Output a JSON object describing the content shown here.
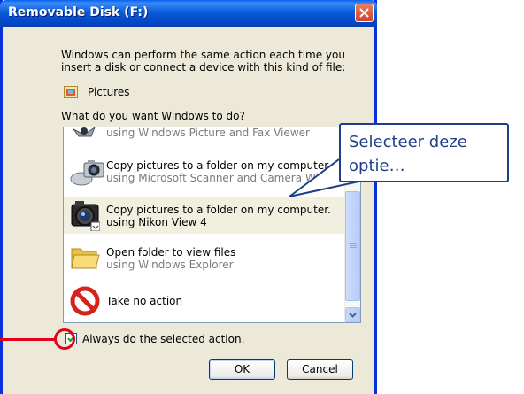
{
  "window": {
    "title": "Removable Disk (F:)"
  },
  "dialog": {
    "description": "Windows can perform the same action each time you insert a disk or connect a device with this kind of file:",
    "content_type": "Pictures",
    "question": "What do you want Windows to do?",
    "actions": [
      {
        "line1": "using Windows Picture and Fax Viewer",
        "line2": "",
        "icon": "windows-picture-viewer-icon"
      },
      {
        "line1": "Copy pictures to a folder on my computer",
        "line2": "using Microsoft Scanner and Camera Wizard",
        "icon": "scanner-camera-icon"
      },
      {
        "line1": "Copy pictures to a folder on my computer.",
        "line2": "using Nikon View 4",
        "icon": "nikon-camera-icon",
        "selected": true
      },
      {
        "line1": "Open folder to view files",
        "line2": "using Windows Explorer",
        "icon": "folder-icon"
      },
      {
        "line1": "Take no action",
        "line2": "",
        "icon": "no-action-icon"
      }
    ],
    "always_label": "Always do the selected action.",
    "always_checked": true,
    "ok_label": "OK",
    "cancel_label": "Cancel"
  },
  "callout": {
    "line1": "Selecteer deze",
    "line2": "optie…"
  },
  "colors": {
    "titlebar": "#0b5bd8",
    "callout_border": "#1e3f88",
    "highlight": "#e2001a"
  }
}
